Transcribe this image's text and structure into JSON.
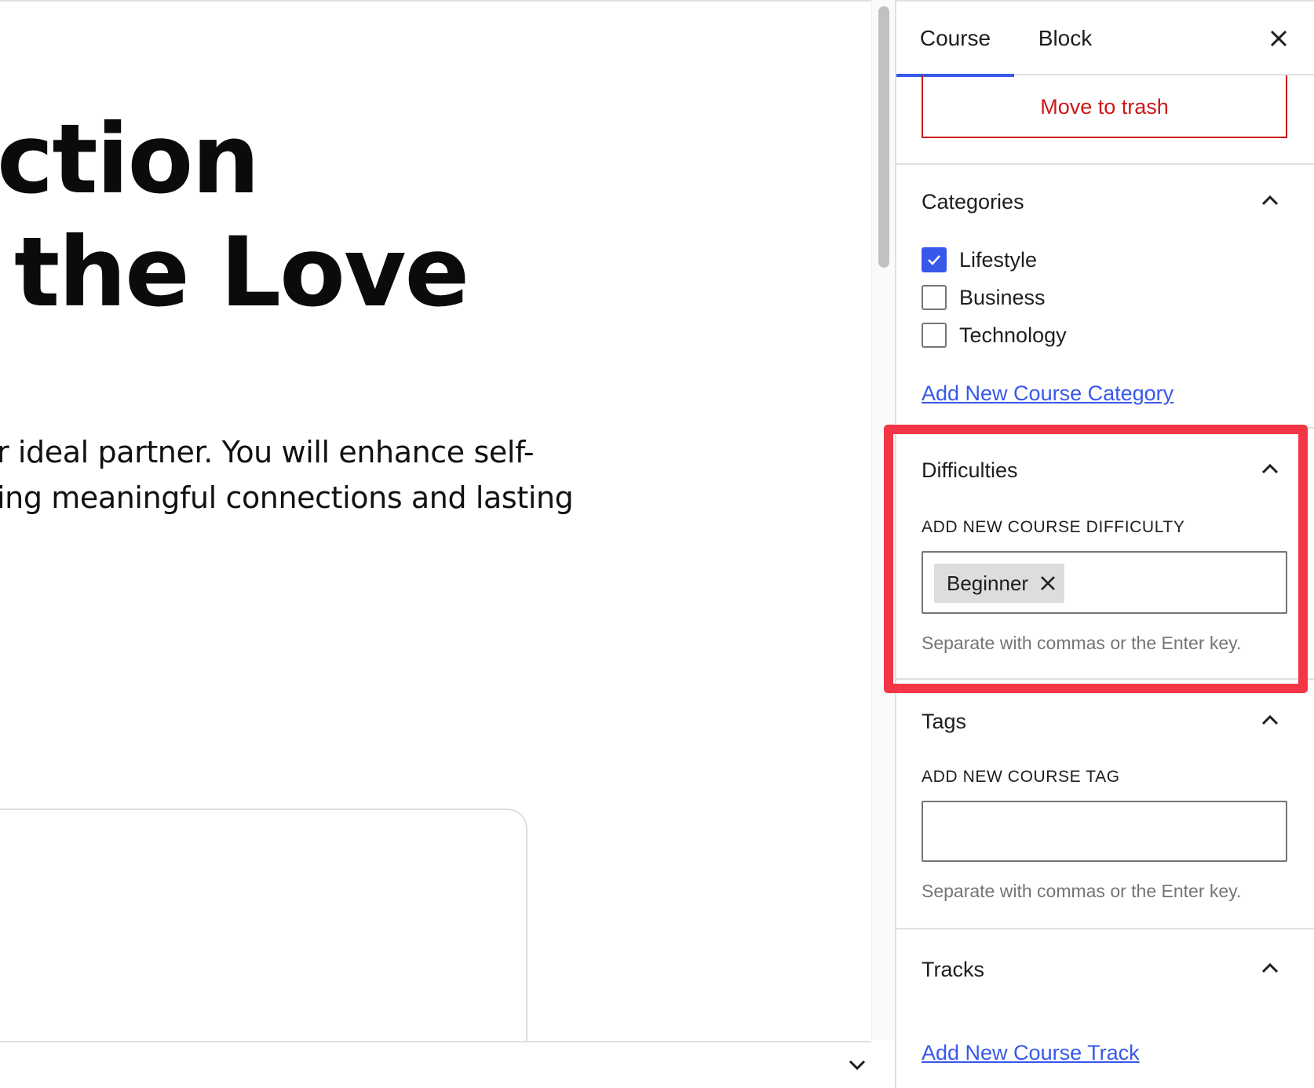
{
  "canvas": {
    "headline_line1": "ction",
    "headline_line2": "the Love",
    "paragraph_line1": "r ideal partner. You will enhance self-",
    "paragraph_line2": "ing meaningful connections and lasting"
  },
  "sidebar": {
    "tabs": [
      {
        "label": "Course",
        "active": true
      },
      {
        "label": "Block",
        "active": false
      }
    ],
    "trash_label": "Move to trash",
    "categories": {
      "title": "Categories",
      "items": [
        {
          "label": "Lifestyle",
          "checked": true
        },
        {
          "label": "Business",
          "checked": false
        },
        {
          "label": "Technology",
          "checked": false
        }
      ],
      "add_link": "Add New Course Category"
    },
    "difficulties": {
      "title": "Difficulties",
      "field_label": "ADD NEW COURSE DIFFICULTY",
      "tokens": [
        "Beginner"
      ],
      "help": "Separate with commas or the Enter key."
    },
    "tags": {
      "title": "Tags",
      "field_label": "ADD NEW COURSE TAG",
      "value": "",
      "help": "Separate with commas or the Enter key."
    },
    "tracks": {
      "title": "Tracks",
      "add_link": "Add New Course Track"
    }
  },
  "colors": {
    "accent": "#3858e9",
    "danger": "#cc1818",
    "highlight": "#f23645"
  },
  "icons": {
    "close": "close-icon",
    "collapse": "chevron-up-icon",
    "expand": "chevron-down-icon",
    "check": "check-icon",
    "remove_token": "close-icon"
  }
}
